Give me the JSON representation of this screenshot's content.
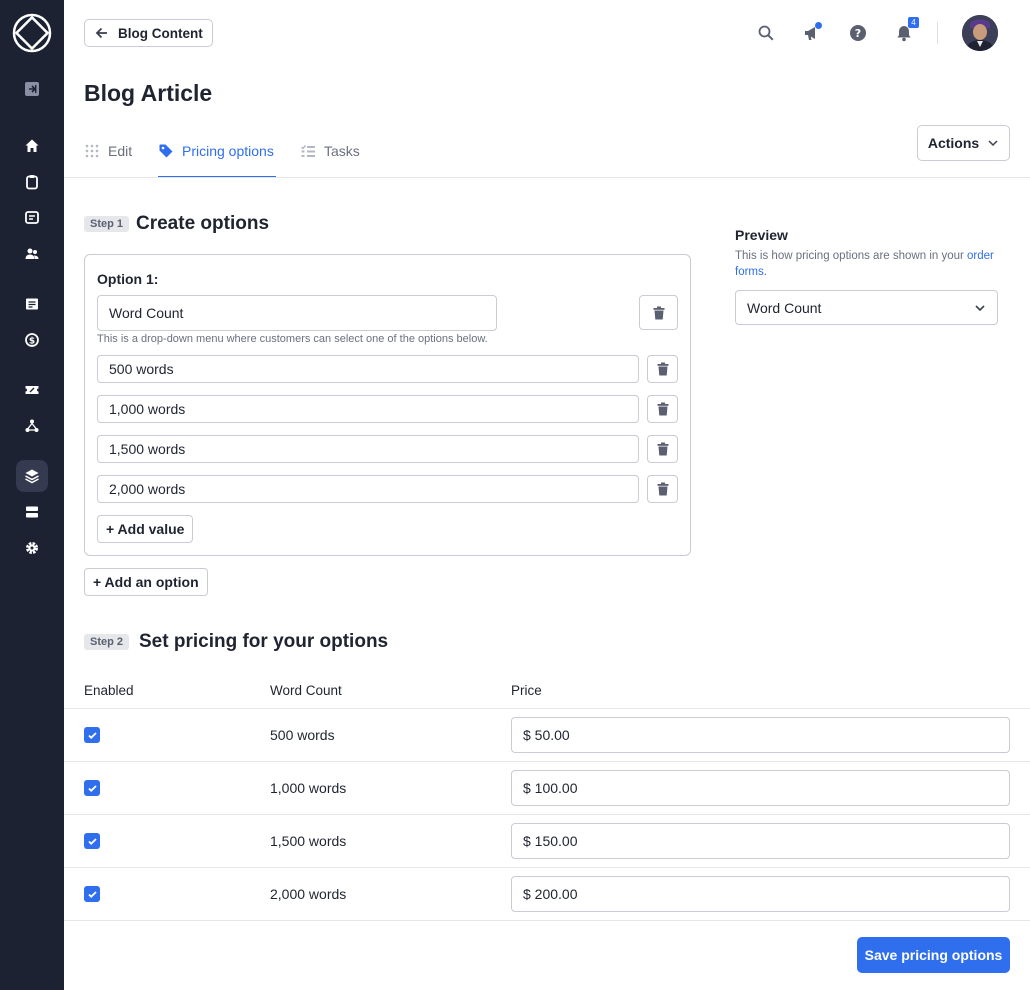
{
  "colors": {
    "accent": "#2f6fed",
    "sidebar": "#1d2233"
  },
  "sidebar": {
    "icons": [
      "logo-icon",
      "collapse-icon",
      "home-icon",
      "orders-icon",
      "messages-icon",
      "clients-icon",
      "invoices-icon",
      "payments-icon",
      "coupons-icon",
      "affiliates-icon",
      "services-icon",
      "storage-icon",
      "settings-icon"
    ]
  },
  "header": {
    "back_label": "Blog Content",
    "notifications_count": "4"
  },
  "page": {
    "title": "Blog Article"
  },
  "tabs": [
    {
      "label": "Edit",
      "icon": "grid-icon"
    },
    {
      "label": "Pricing options",
      "icon": "tag-icon"
    },
    {
      "label": "Tasks",
      "icon": "tasks-icon"
    }
  ],
  "actions_label": "Actions",
  "step1": {
    "tag": "Step 1",
    "title": "Create options",
    "option_label": "Option 1:",
    "option_name": "Word Count",
    "help": "This is a drop-down menu where customers can select one of the options below.",
    "values": [
      "500 words",
      "1,000 words",
      "1,500 words",
      "2,000 words"
    ],
    "add_value_label": "+ Add value",
    "add_option_label": "+ Add an option"
  },
  "preview": {
    "title": "Preview",
    "desc_prefix": "This is how pricing options are shown in your ",
    "desc_link": "order forms.",
    "selected": "Word Count"
  },
  "step2": {
    "tag": "Step 2",
    "title": "Set pricing for your options",
    "columns": [
      "Enabled",
      "Word Count",
      "Price"
    ],
    "rows": [
      {
        "enabled": true,
        "name": "500 words",
        "price": "$ 50.00"
      },
      {
        "enabled": true,
        "name": "1,000 words",
        "price": "$ 100.00"
      },
      {
        "enabled": true,
        "name": "1,500 words",
        "price": "$ 150.00"
      },
      {
        "enabled": true,
        "name": "2,000 words",
        "price": "$ 200.00"
      }
    ]
  },
  "save_label": "Save pricing options"
}
